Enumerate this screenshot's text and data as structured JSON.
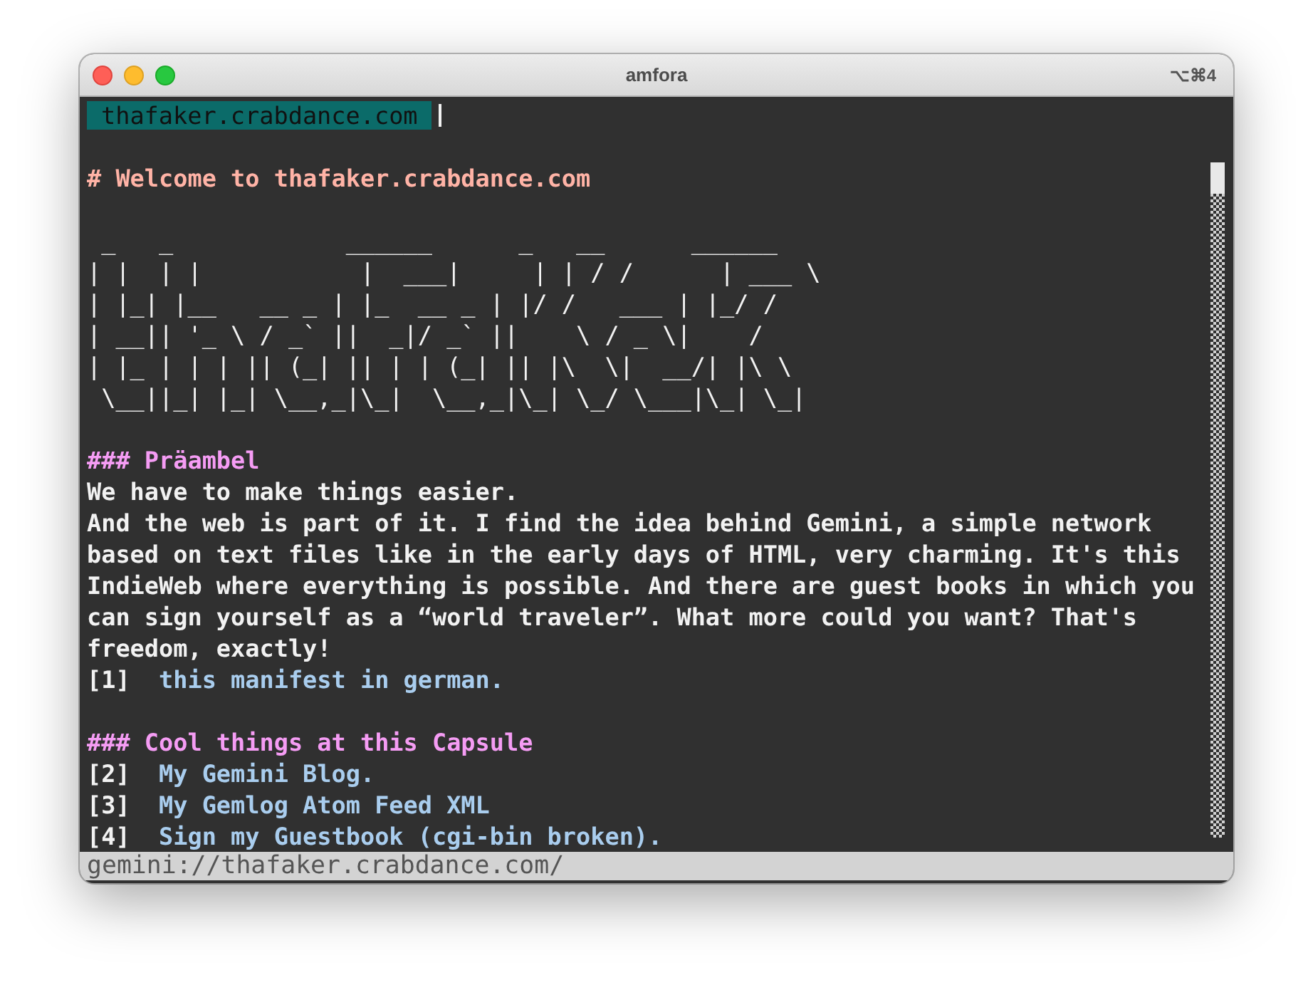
{
  "window": {
    "title": "amfora",
    "shortcut": "⌥⌘4"
  },
  "address_bar": {
    "value": "thafaker.crabdance.com"
  },
  "content": [
    {
      "kind": "h1",
      "text": "# Welcome to thafaker.crabdance.com"
    },
    {
      "kind": "art",
      "lines": [
        " _   _            ______      _   __      ______",
        "| |  | |           |  ___|     | | / /      | ___ \\",
        "| |_| |__   __ _ | |_  __ _ | |/ /   ___ | |_/ /",
        "| __|| '_ \\ / _` ||  _|/ _` ||    \\ / _ \\|    /",
        "| |_ | | | || (_| || | | (_| || |\\  \\|  __/| |\\ \\",
        " \\__||_| |_| \\__,_|\\_|  \\__,_|\\_| \\_/ \\___|\\_| \\_|"
      ]
    },
    {
      "kind": "h3",
      "text": "### Präambel"
    },
    {
      "kind": "text",
      "text": "We have to make things easier."
    },
    {
      "kind": "text",
      "text": "And the web is part of it. I find the idea behind Gemini, a simple network based on text files like in the early days of HTML, very charming. It's this IndieWeb where everything is possible. And there are guest books in which you can sign yourself as a “world traveler”. What more could you want? That's freedom, exactly!"
    },
    {
      "kind": "link",
      "number": "[1]",
      "label": "this manifest in german."
    },
    {
      "kind": "h3",
      "text": "### Cool things at this Capsule"
    },
    {
      "kind": "link",
      "number": "[2]",
      "label": "My Gemini Blog."
    },
    {
      "kind": "link",
      "number": "[3]",
      "label": "My Gemlog Atom Feed XML"
    },
    {
      "kind": "link",
      "number": "[4]",
      "label": "Sign my Guestbook (cgi-bin broken)."
    }
  ],
  "status_bar": {
    "url": "gemini://thafaker.crabdance.com/"
  }
}
